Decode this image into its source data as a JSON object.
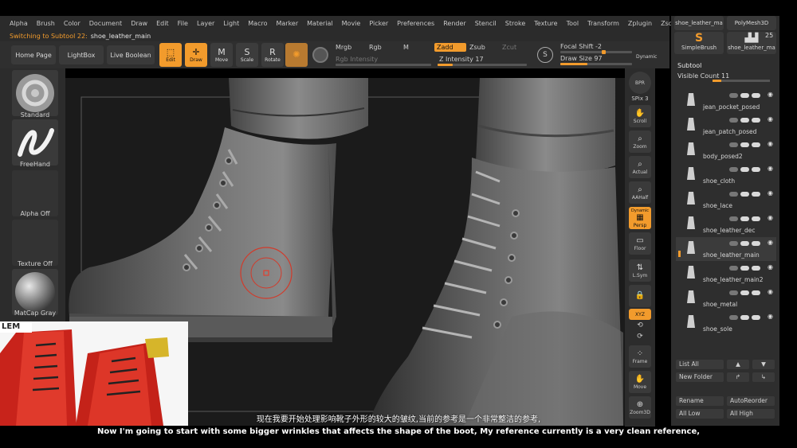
{
  "menu": [
    "Alpha",
    "Brush",
    "Color",
    "Document",
    "Draw",
    "Edit",
    "File",
    "Layer",
    "Light",
    "Macro",
    "Marker",
    "Material",
    "Movie",
    "Picker",
    "Preferences",
    "Render",
    "Stencil",
    "Stroke",
    "Texture",
    "Tool",
    "Transform",
    "Zplugin",
    "Zscript"
  ],
  "status": {
    "prefix": "Switching to Subtool 22:",
    "name": "shoe_leather_main"
  },
  "shelf": {
    "home": "Home Page",
    "lightbox": "LightBox",
    "live_boolean": "Live Boolean",
    "edit": "Edit",
    "draw": "Draw",
    "move": "Move",
    "scale": "Scale",
    "rotate": "Rotate",
    "mrgb": "Mrgb",
    "rgb": "Rgb",
    "m": "M",
    "rgb_intensity": "Rgb Intensity",
    "zadd": "Zadd",
    "zsub": "Zsub",
    "zcut": "Zcut",
    "z_intensity": "Z Intensity 17",
    "focal_shift": "Focal Shift -2",
    "draw_size": "Draw Size 97",
    "dynamic": "Dynamic"
  },
  "brushes": [
    {
      "label": "Standard"
    },
    {
      "label": "FreeHand"
    },
    {
      "label": "Alpha Off"
    },
    {
      "label": "Texture Off"
    },
    {
      "label": "MatCap Gray"
    }
  ],
  "right_tools": {
    "bpr": "BPR",
    "spix": "SPix 3",
    "scroll": "Scroll",
    "zoom": "Zoom",
    "actual": "Actual",
    "aahalf": "AAHalf",
    "dynamic": "Dynamic",
    "persp": "Persp",
    "floor": "Floor",
    "lsym": "L.Sym",
    "xyz": "XYZ",
    "frame": "Frame",
    "move": "Move",
    "zoom3d": "Zoom3D"
  },
  "tray": {
    "top_items": [
      "shoe_leather_ma",
      "PolyMesh3D",
      "SimpleBrush",
      "shoe_leather_ma"
    ],
    "top_count": "25",
    "subtool_header": "Subtool",
    "visible_count": "Visible Count 11",
    "subtools": [
      "jean_pocket_posed",
      "jean_patch_posed",
      "body_posed2",
      "shoe_cloth",
      "shoe_lace",
      "shoe_leather_dec",
      "shoe_leather_main",
      "shoe_leather_main2",
      "shoe_metal",
      "shoe_sole"
    ],
    "buttons": {
      "list_all": "List All",
      "new_folder": "New Folder",
      "rename": "Rename",
      "auto_reorder": "AutoReorder",
      "all_low": "All Low",
      "all_high": "All High"
    }
  },
  "reference_caption": "LEM",
  "subtitles": {
    "cn": "现在我要开始处理影响靴子外形的较大的皱纹,当前的参考是一个非常整洁的参考,",
    "en": "Now I'm going to start with some bigger wrinkles that affects the shape of the boot, My reference currently is a very clean reference,"
  },
  "colors": {
    "accent": "#f29b2c",
    "panel": "#2c2c2c",
    "viewport": "#1a1a1a"
  }
}
